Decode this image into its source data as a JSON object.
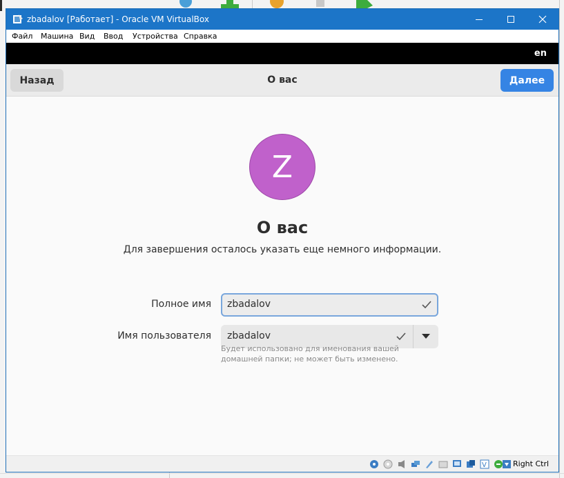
{
  "window": {
    "title": "zbadalov [Работает] - Oracle VM VirtualBox"
  },
  "menubar": {
    "items": [
      "Файл",
      "Машина",
      "Вид",
      "Ввод",
      "Устройства",
      "Справка"
    ]
  },
  "topbar": {
    "language": "en"
  },
  "header": {
    "back_label": "Назад",
    "title": "О вас",
    "next_label": "Далее"
  },
  "main": {
    "avatar_letter": "Z",
    "heading": "О вас",
    "subtitle": "Для завершения осталось указать еще немного информации.",
    "full_name_label": "Полное имя",
    "full_name_value": "zbadalov",
    "username_label": "Имя пользователя",
    "username_value": "zbadalov",
    "username_hint": "Будет использовано для именования вашей домашней папки; не может быть изменено."
  },
  "statusbar": {
    "host_key": "Right Ctrl",
    "icons": [
      "hard-disk-icon",
      "optical-drive-icon",
      "audio-icon",
      "network-icon",
      "usb-icon",
      "shared-folders-icon",
      "display-icon",
      "video-capture-icon",
      "virtualization-icon",
      "mouse-integration-icon",
      "keyboard-capture-icon"
    ]
  },
  "colors": {
    "titlebar": "#1c75c8",
    "accent": "#3584e4",
    "avatar": "#c061cb"
  }
}
